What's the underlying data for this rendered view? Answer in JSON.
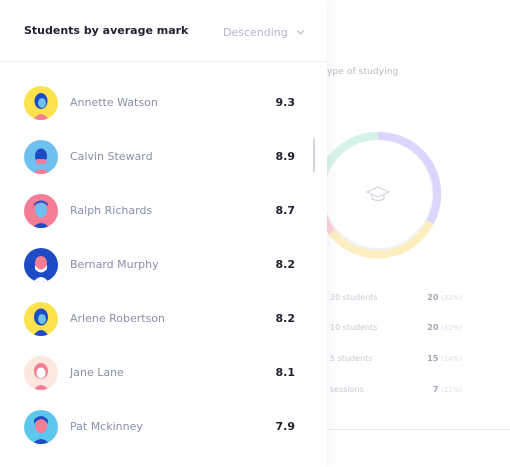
{
  "background": {
    "title": "ype of studying",
    "rows": [
      {
        "label": "20 students",
        "value": "20",
        "pct": "(32%)"
      },
      {
        "label": "10 students",
        "value": "20",
        "pct": "(32%)"
      },
      {
        "label": "5 students",
        "value": "15",
        "pct": "(24%)"
      },
      {
        "label": "sessions",
        "value": "7",
        "pct": "(12%)"
      }
    ],
    "donut_colors": [
      "#dcd6ff",
      "#fdeec0",
      "#fbd3d8",
      "#d6f3ea"
    ],
    "donut_icon": "graduation-cap-icon"
  },
  "card": {
    "title": "Students by average mark",
    "sort_label": "Descending",
    "sort_icon": "chevron-down-icon"
  },
  "students": [
    {
      "name": "Annette Watson",
      "mark": "9.3",
      "bg": "#fde24d",
      "avatar": "woman-icon"
    },
    {
      "name": "Calvin Steward",
      "mark": "8.9",
      "bg": "#6dc0f0",
      "avatar": "man-icon"
    },
    {
      "name": "Ralph Richards",
      "mark": "8.7",
      "bg": "#f47c95",
      "avatar": "man-icon"
    },
    {
      "name": "Bernard Murphy",
      "mark": "8.2",
      "bg": "#1d4bc5",
      "avatar": "man-icon"
    },
    {
      "name": "Arlene Robertson",
      "mark": "8.2",
      "bg": "#fde24d",
      "avatar": "woman-icon"
    },
    {
      "name": "Jane Lane",
      "mark": "8.1",
      "bg": "#fde7de",
      "avatar": "woman-icon"
    },
    {
      "name": "Pat Mckinney",
      "mark": "7.9",
      "bg": "#5dc6ee",
      "avatar": "man-icon"
    }
  ]
}
